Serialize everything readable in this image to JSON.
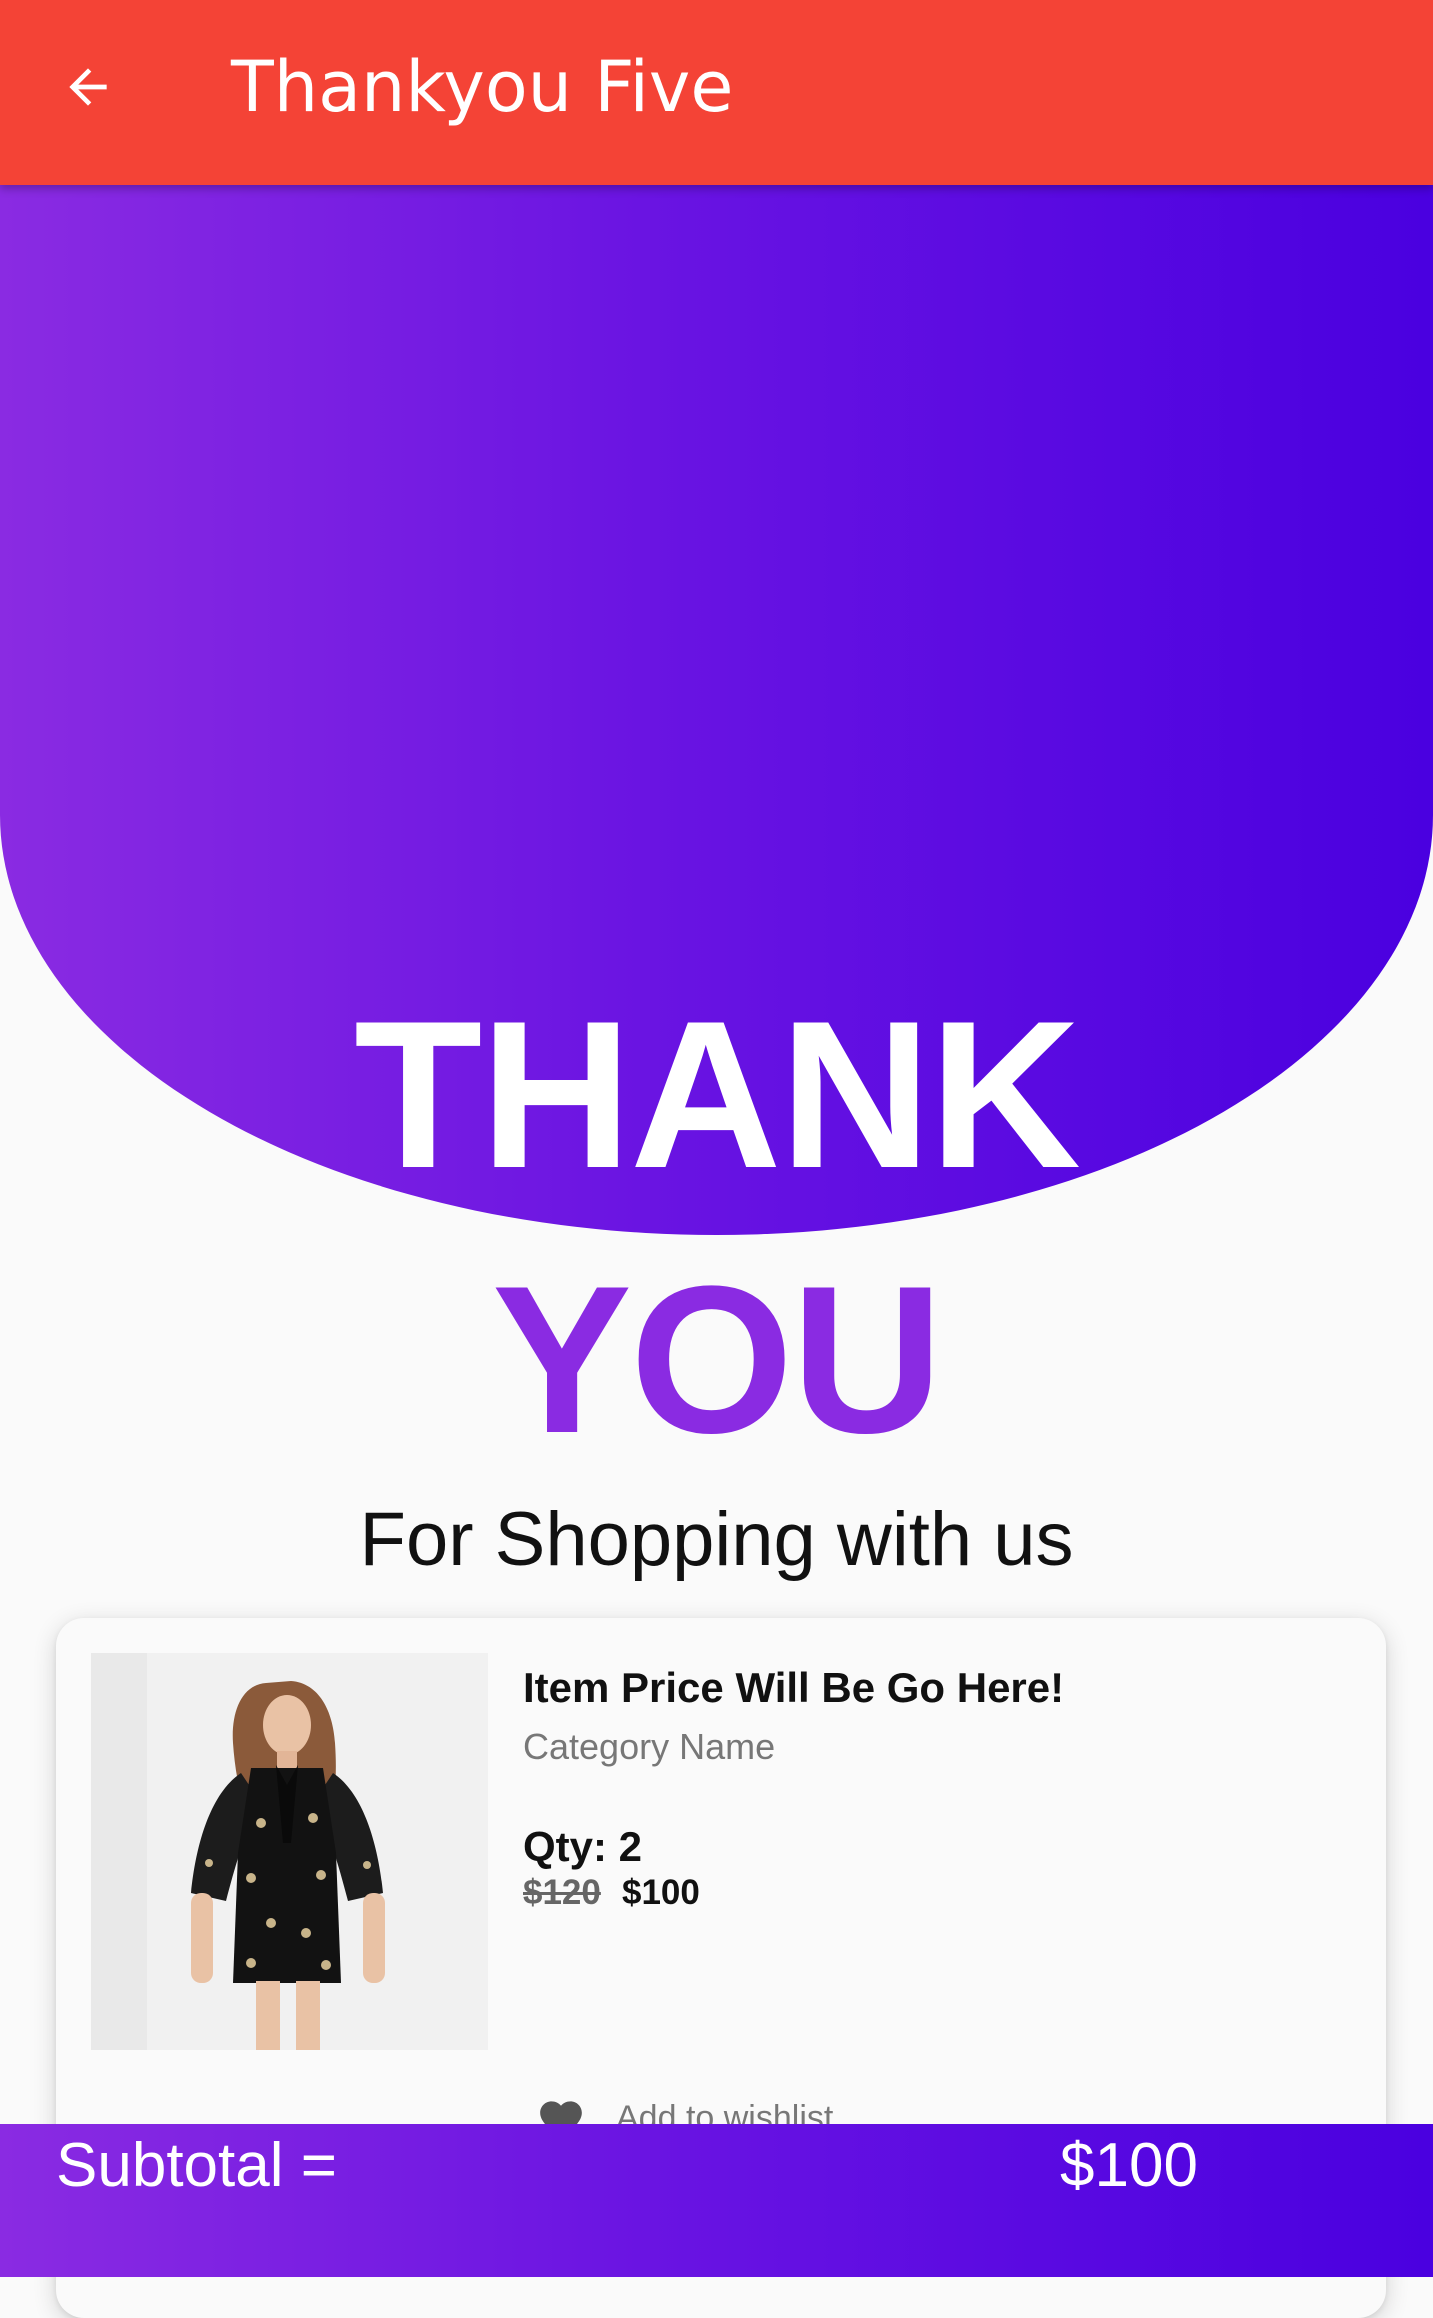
{
  "app_bar": {
    "title": "Thankyou Five",
    "back_icon": "arrow-left-icon",
    "background_color": "#f44336"
  },
  "hero": {
    "line1": "THANK",
    "line2": "YOU",
    "subheading": "For Shopping with us",
    "gradient_start": "#8a2be2",
    "gradient_end": "#4a00e0",
    "accent_color": "#8a2be2"
  },
  "product": {
    "title": "Item Price Will Be Go Here!",
    "category": "Category Name",
    "qty_label": "Qty: 2",
    "old_price": "$120",
    "new_price": "$100",
    "image_icon": "product-photo-dress",
    "wishlist_icon": "heart-icon",
    "wishlist_label": "Add to wishlist"
  },
  "footer": {
    "subtotal_label": "Subtotal =",
    "subtotal_value": "$100"
  }
}
